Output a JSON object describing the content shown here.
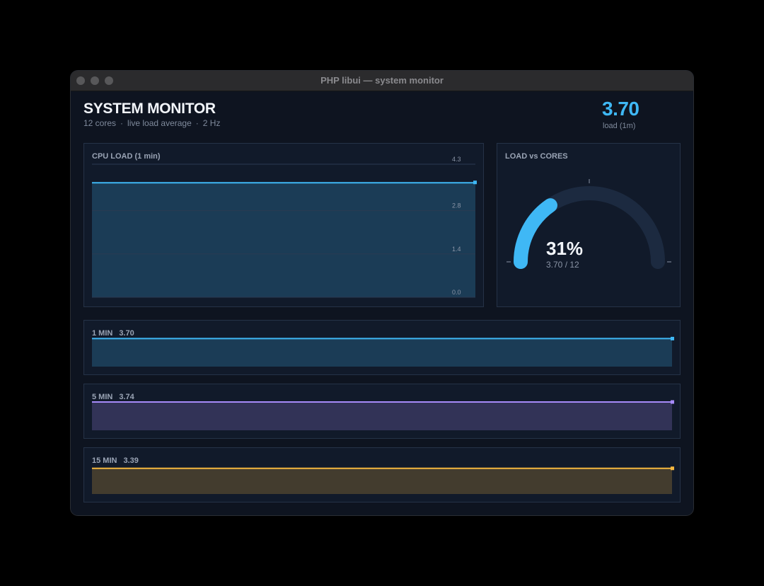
{
  "window": {
    "title": "PHP libui — system monitor"
  },
  "header": {
    "title": "SYSTEM MONITOR",
    "cores": "12 cores",
    "mode": "live load average",
    "rate": "2 Hz",
    "load_value": "3.70",
    "load_label": "load (1m)"
  },
  "cpu_panel": {
    "label": "CPU LOAD (1 min)"
  },
  "gauge_panel": {
    "label": "LOAD vs CORES",
    "percent": "31%",
    "ratio": "3.70 / 12",
    "fraction": 0.308
  },
  "mini_panels": [
    {
      "label": "1 MIN",
      "value": "3.70"
    },
    {
      "label": "5 MIN",
      "value": "3.74"
    },
    {
      "label": "15 MIN",
      "value": "3.39"
    }
  ],
  "colors": {
    "accent": "#3fb8f5",
    "m1": "#3fb8f5",
    "m5": "#a78bfa",
    "m15": "#f5b73f",
    "gauge_track": "#1c2a40"
  },
  "chart_data": [
    {
      "type": "area",
      "title": "CPU LOAD (1 min)",
      "ylim": [
        0,
        4.3
      ],
      "yticks": [
        "4.3",
        "2.8",
        "1.4",
        "0.0"
      ],
      "ytick_values": [
        4.3,
        2.8,
        1.4,
        0.0
      ],
      "series": [
        {
          "values": [
            3.7,
            3.7
          ]
        }
      ],
      "grid": true
    },
    {
      "type": "area",
      "title": "1 MIN",
      "ylim": [
        0,
        4.3
      ],
      "series": [
        {
          "values": [
            3.7,
            3.7
          ]
        }
      ]
    },
    {
      "type": "area",
      "title": "5 MIN",
      "ylim": [
        0,
        4.3
      ],
      "series": [
        {
          "values": [
            3.74,
            3.74
          ]
        }
      ]
    },
    {
      "type": "area",
      "title": "15 MIN",
      "ylim": [
        0,
        4.3
      ],
      "series": [
        {
          "values": [
            3.39,
            3.39
          ]
        }
      ]
    }
  ]
}
